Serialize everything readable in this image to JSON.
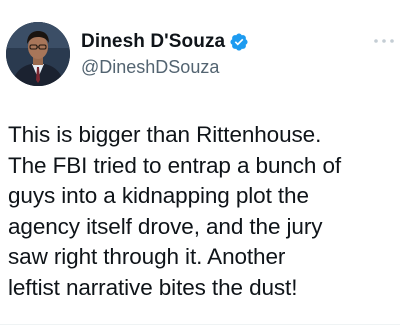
{
  "tweet": {
    "author": {
      "display_name": "Dinesh D'Souza",
      "handle": "@DineshDSouza",
      "verified": true,
      "avatar_icon": "profile-photo-man-suit"
    },
    "text": "This is bigger than Rittenhouse.\nThe FBI tried to entrap a bunch of\nguys into a kidnapping plot the\nagency itself drove, and the jury\nsaw right through it. Another\nleftist narrative bites the dust!"
  },
  "colors": {
    "verified_badge": "#1d9bf0",
    "handle_text": "#536471",
    "body_text": "#0f1419"
  }
}
